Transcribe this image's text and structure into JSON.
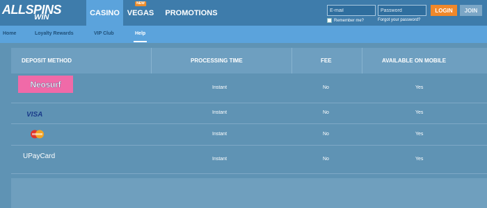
{
  "brand": {
    "line1": "ALLSPINS",
    "line2": "WIN"
  },
  "nav": {
    "items": [
      {
        "label": "CASINO",
        "active": true
      },
      {
        "label": "VEGAS",
        "badge": "NEW"
      },
      {
        "label": "PROMOTIONS"
      }
    ]
  },
  "auth": {
    "email_placeholder": "E-mail",
    "password_placeholder": "Password",
    "login_label": "LOGIN",
    "join_label": "JOIN",
    "remember_label": "Remember me?",
    "forgot_label": "Forgot your password?"
  },
  "subnav": {
    "items": [
      {
        "label": "Home"
      },
      {
        "label": "Loyalty Rewards"
      },
      {
        "label": "VIP Club"
      },
      {
        "label": "Help",
        "active": true
      }
    ]
  },
  "table": {
    "headers": [
      "DEPOSIT METHOD",
      "PROCESSING TIME",
      "FEE",
      "AVAILABLE ON MOBILE"
    ],
    "rows": [
      {
        "method": "Neosurf",
        "time": "Instant",
        "fee": "No",
        "mobile": "Yes"
      },
      {
        "method": "VISA",
        "time": "Instant",
        "fee": "No",
        "mobile": "Yes"
      },
      {
        "method": "MasterCard",
        "time": "Instant",
        "fee": "No",
        "mobile": "Yes"
      },
      {
        "method": "UPayCard",
        "time": "Instant",
        "fee": "No",
        "mobile": "Yes"
      }
    ]
  },
  "colors": {
    "header_bg": "#3e7cab",
    "accent_blue": "#5ba3dc",
    "login_orange": "#f0882a",
    "page_bg": "#5f93b4"
  }
}
